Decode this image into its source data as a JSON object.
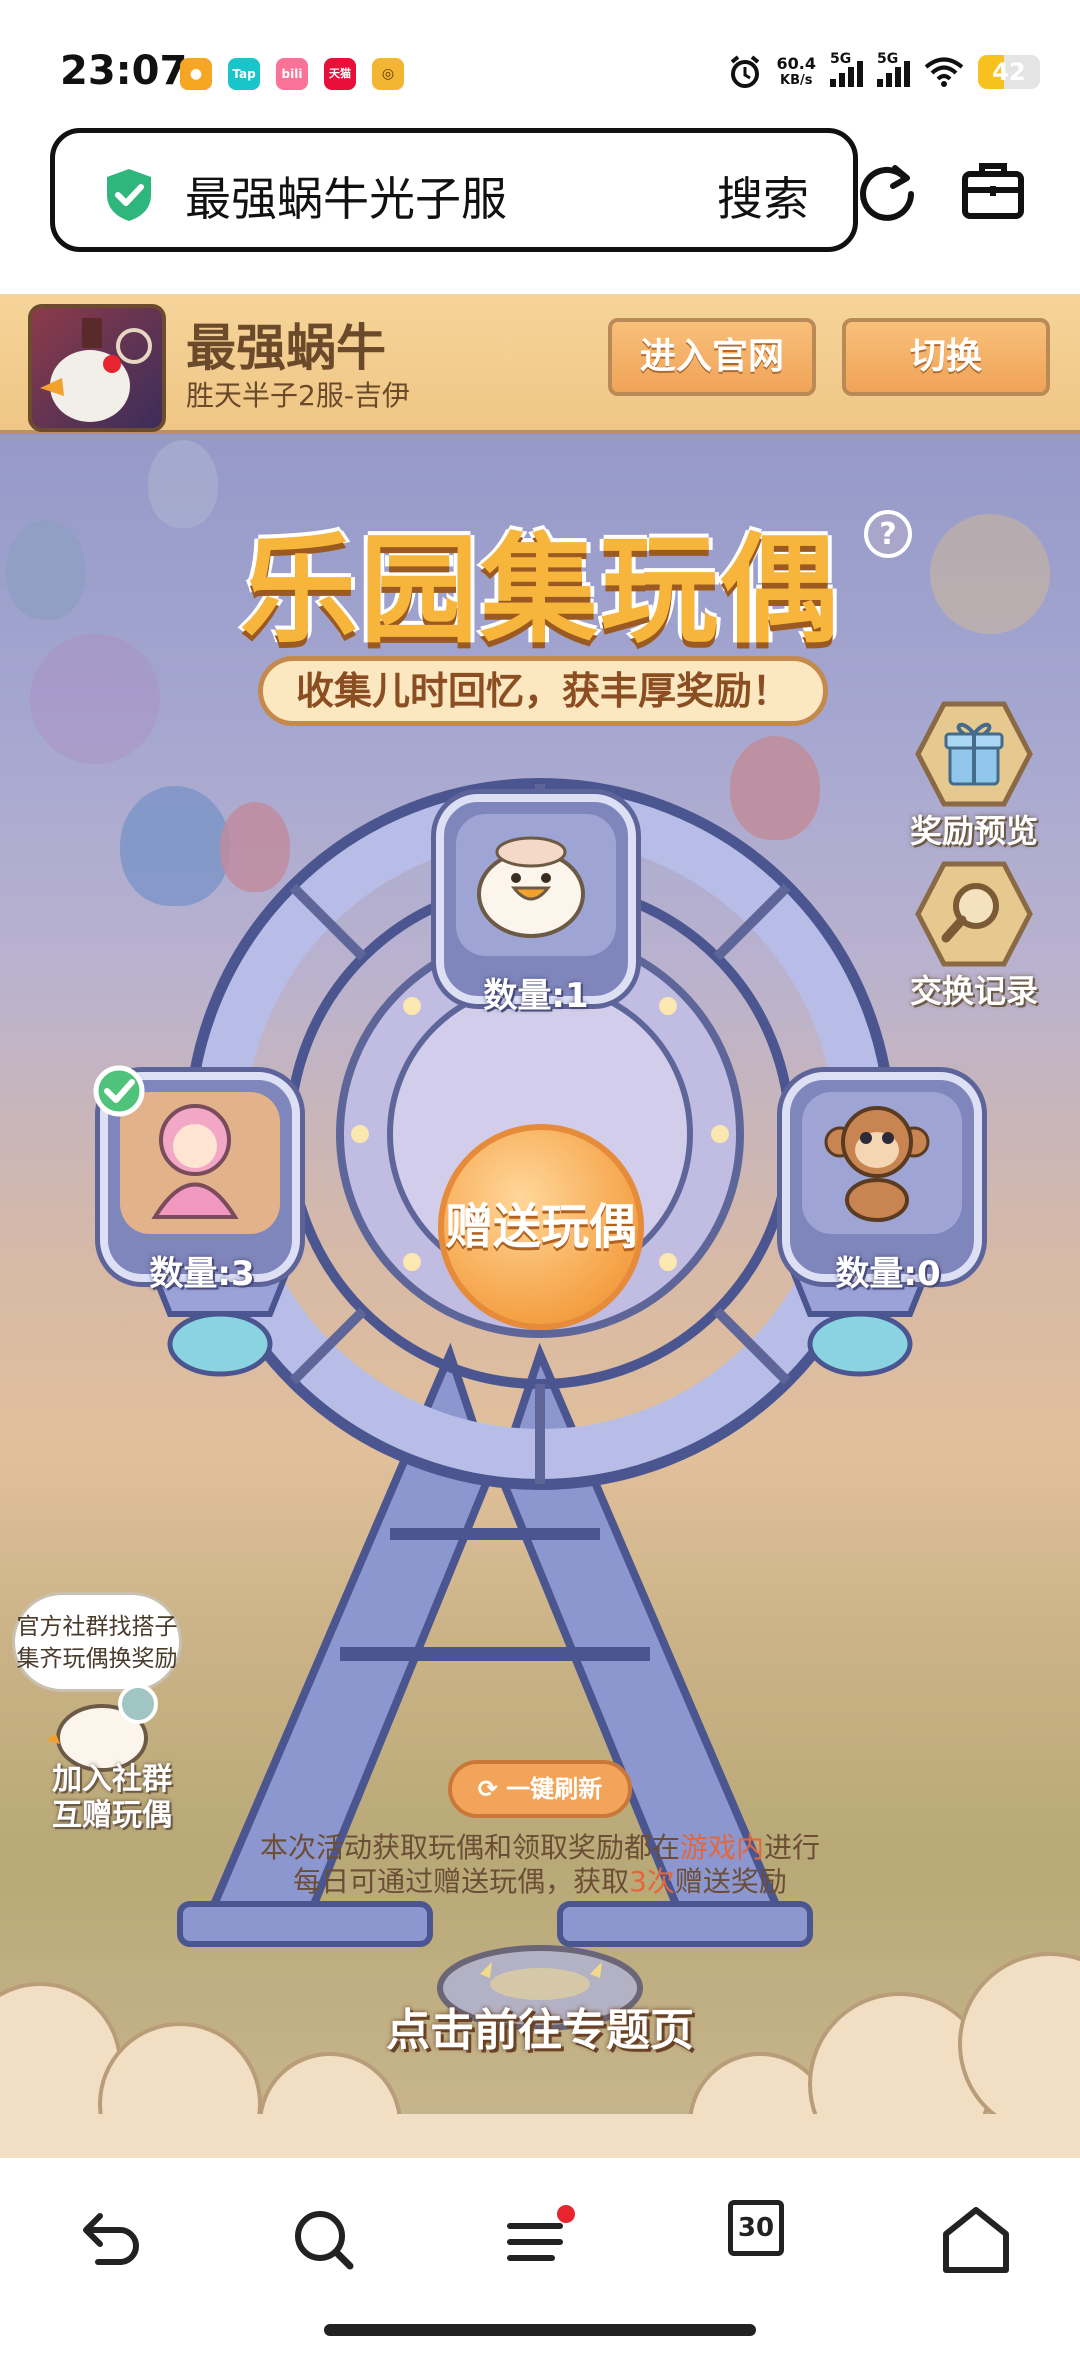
{
  "status_bar": {
    "time": "23:07",
    "notification_icons": [
      {
        "name": "weibo-icon",
        "text": "",
        "color": "#f5a623"
      },
      {
        "name": "taptap-icon",
        "text": "Tap",
        "color": "#18c5c8"
      },
      {
        "name": "bilibili-icon",
        "text": "bili",
        "color": "#fb7299"
      },
      {
        "name": "tmall-icon",
        "text": "天猫",
        "color": "#e8103a"
      },
      {
        "name": "app-icon",
        "text": "◎",
        "color": "#f3b632"
      }
    ],
    "net_speed_value": "60.4",
    "net_speed_unit": "KB/s",
    "signal_1": "5G",
    "signal_2": "5G",
    "battery_percent": "42",
    "battery_level": 0.42
  },
  "browser": {
    "search_query": "最强蜗牛光子服",
    "search_button": "搜索"
  },
  "game_header": {
    "game_name": "最强蜗牛",
    "server_info": "胜天半子2服-吉伊",
    "official_site_button": "进入官网",
    "switch_button": "切换"
  },
  "event": {
    "title": "乐园集玩偶",
    "subtitle": "收集儿时回忆，获丰厚奖励！",
    "reward_preview": "奖励预览",
    "exchange_record": "交换记录",
    "dolls": [
      {
        "name": "duck-doll",
        "count": "数量:1",
        "collected": false
      },
      {
        "name": "girl-doll",
        "count": "数量:3",
        "collected": true
      },
      {
        "name": "monkey-doll",
        "count": "数量:0",
        "collected": false
      }
    ],
    "gift_button": "赠送玩偶",
    "social_hint": "官方社群找搭子\n集齐玩偶换奖励",
    "social_hint_line1": "官方社群找搭子",
    "social_hint_line2": "集齐玩偶换奖励",
    "join_group_line1": "加入社群",
    "join_group_line2": "互赠玩偶",
    "refresh_button": "一键刷新",
    "notice_line1_a": "本次活动获取玩偶和领取奖励都在",
    "notice_line1_hl": "游戏内",
    "notice_line1_b": "进行",
    "notice_line2_a": "每日可通过赠送玩偶，获取",
    "notice_line2_hl": "3次",
    "notice_line2_b": "赠送奖励",
    "topic_button": "点击前往专题页"
  },
  "bottom_nav": {
    "tab_count": "30"
  },
  "colors": {
    "accent_orange": "#f5a246",
    "header_bg": "#f6d49a",
    "highlight_red": "#e4673c",
    "shield_green": "#2fb67c"
  }
}
